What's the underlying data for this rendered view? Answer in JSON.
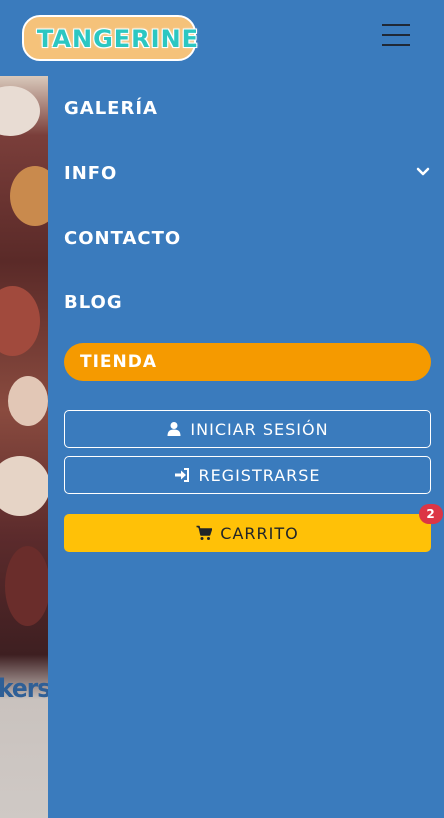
{
  "brand": {
    "logo_text": "TANGERINE"
  },
  "header": {
    "menu_toggle_icon": "hamburger-icon"
  },
  "nav": {
    "items": [
      {
        "label": "GALERÍA"
      },
      {
        "label": "INFO",
        "icon": "chevron-down-icon"
      },
      {
        "label": "CONTACTO"
      },
      {
        "label": "BLOG"
      }
    ],
    "shop": {
      "label": "TIENDA"
    }
  },
  "account": {
    "login": {
      "label": "INICIAR SESIÓN",
      "icon": "user-icon"
    },
    "register": {
      "label": "REGISTRARSE",
      "icon": "sign-in-icon"
    },
    "cart": {
      "label": "CARRITO",
      "icon": "cart-icon",
      "count": "2"
    }
  },
  "background": {
    "partial_text": "kers, p"
  },
  "colors": {
    "primary": "#3a7bbd",
    "shop_button": "#f59a00",
    "cart_button": "#ffc107",
    "badge": "#dc3545"
  }
}
